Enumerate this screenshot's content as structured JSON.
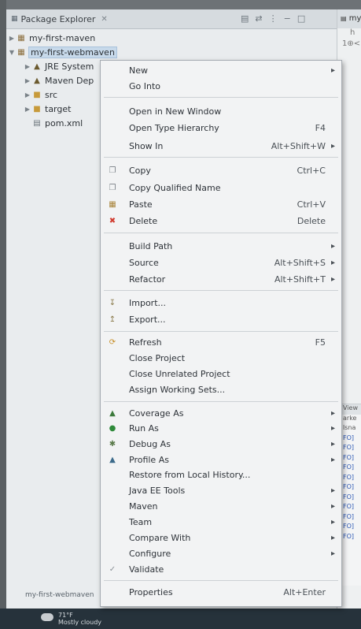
{
  "explorer": {
    "tab_title": "Package Explorer",
    "tree": [
      {
        "label": "my-first-maven"
      },
      {
        "label": "my-first-webmaven"
      },
      {
        "label": "JRE System"
      },
      {
        "label": "Maven Dep"
      },
      {
        "label": "src"
      },
      {
        "label": "target"
      },
      {
        "label": "pom.xml"
      }
    ],
    "status_label": "my-first-webmaven"
  },
  "editor": {
    "tab": "my-f",
    "line1": "h",
    "line2": "1⊕<"
  },
  "console": {
    "tab": "View",
    "lines": [
      "arke",
      "lsna",
      "FO]",
      "FO]",
      "FO]",
      "FO]",
      "FO]",
      "FO]",
      "FO]",
      "FO]",
      "FO]",
      "FO]",
      "FO]"
    ]
  },
  "taskbar": {
    "temperature": "71°F",
    "weather": "Mostly cloudy"
  },
  "menu": {
    "new": {
      "label": "New"
    },
    "go_into": {
      "label": "Go Into"
    },
    "open_new_window": {
      "label": "Open in New Window"
    },
    "open_type_hierarchy": {
      "label": "Open Type Hierarchy",
      "accel": "F4"
    },
    "show_in": {
      "label": "Show In",
      "accel": "Alt+Shift+W"
    },
    "copy": {
      "label": "Copy",
      "accel": "Ctrl+C"
    },
    "copy_qualified": {
      "label": "Copy Qualified Name"
    },
    "paste": {
      "label": "Paste",
      "accel": "Ctrl+V"
    },
    "delete": {
      "label": "Delete",
      "accel": "Delete"
    },
    "build_path": {
      "label": "Build Path"
    },
    "source": {
      "label": "Source",
      "accel": "Alt+Shift+S"
    },
    "refactor": {
      "label": "Refactor",
      "accel": "Alt+Shift+T"
    },
    "import": {
      "label": "Import..."
    },
    "export": {
      "label": "Export..."
    },
    "refresh": {
      "label": "Refresh",
      "accel": "F5"
    },
    "close_project": {
      "label": "Close Project"
    },
    "close_unrelated": {
      "label": "Close Unrelated Project"
    },
    "assign_working_sets": {
      "label": "Assign Working Sets..."
    },
    "coverage_as": {
      "label": "Coverage As"
    },
    "run_as": {
      "label": "Run As"
    },
    "debug_as": {
      "label": "Debug As"
    },
    "profile_as": {
      "label": "Profile As"
    },
    "restore_history": {
      "label": "Restore from Local History..."
    },
    "java_ee_tools": {
      "label": "Java EE Tools"
    },
    "maven": {
      "label": "Maven"
    },
    "team": {
      "label": "Team"
    },
    "compare_with": {
      "label": "Compare With"
    },
    "configure": {
      "label": "Configure"
    },
    "validate": {
      "label": "Validate"
    },
    "properties": {
      "label": "Properties",
      "accel": "Alt+Enter"
    }
  },
  "colors": {
    "accent_selection": "#c7d9ea",
    "delete_icon": "#d13b2f",
    "run_icon": "#2f8a3a"
  }
}
